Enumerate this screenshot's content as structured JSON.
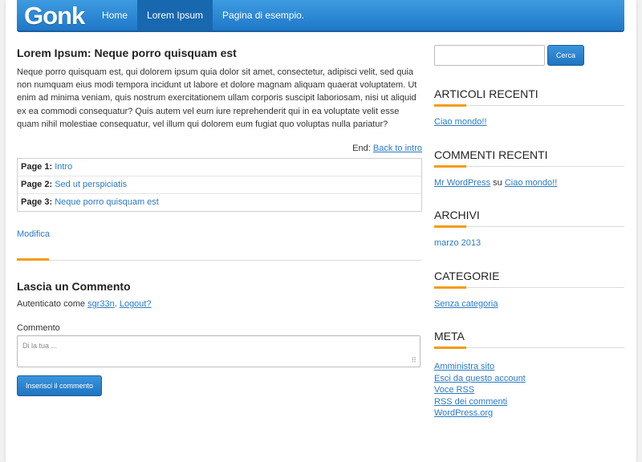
{
  "header": {
    "logo": "Gonk",
    "nav": [
      {
        "label": "Home"
      },
      {
        "label": "Lorem Ipsum"
      },
      {
        "label": "Pagina di esempio."
      }
    ]
  },
  "post": {
    "title": "Lorem Ipsum: Neque porro quisquam est",
    "body": "Neque porro quisquam est, qui dolorem ipsum quia dolor sit amet, consectetur, adipisci velit, sed quia non numquam eius modi tempora incidunt ut labore et dolore magnam aliquam quaerat voluptatem. Ut enim ad minima veniam, quis nostrum exercitationem ullam corporis suscipit laboriosam, nisi ut aliquid ex ea commodi consequatur? Quis autem vel eum iure reprehenderit qui in ea voluptate velit esse quam nihil molestiae consequatur, vel illum qui dolorem eum fugiat quo voluptas nulla pariatur?",
    "end_label": "End:",
    "end_link": "Back to intro",
    "toc": [
      {
        "page": "Page 1:",
        "title": "Intro"
      },
      {
        "page": "Page 2:",
        "title": "Sed ut perspiciatis"
      },
      {
        "page": "Page 3:",
        "title": "Neque porro quisquam est"
      }
    ],
    "edit_label": "Modifica"
  },
  "comment": {
    "title": "Lascia un Commento",
    "logged_prefix": "Autenticato come",
    "user": "sgr33n",
    "logout": "Logout?",
    "field_label": "Commento",
    "placeholder": "Di la tua ...",
    "submit": "Inserisci il commento"
  },
  "sidebar": {
    "search_button": "Cerca",
    "recent_posts_title": "Articoli recenti",
    "recent_posts": [
      "Ciao mondo!!"
    ],
    "recent_comments_title": "Commenti recenti",
    "recent_comment": {
      "author": "Mr WordPress",
      "on": "su",
      "post": "Ciao mondo!!"
    },
    "archives_title": "Archivi",
    "archives": [
      "marzo 2013"
    ],
    "categories_title": "Categorie",
    "categories": [
      "Senza categoria"
    ],
    "meta_title": "Meta",
    "meta": [
      "Amministra sito",
      "Esci da questo account",
      "Voce RSS",
      "RSS dei commenti",
      "WordPress.org"
    ]
  },
  "colors": {
    "accent": "#2a7ac6",
    "header": "#1f78c8",
    "underline": "#f39c12"
  }
}
